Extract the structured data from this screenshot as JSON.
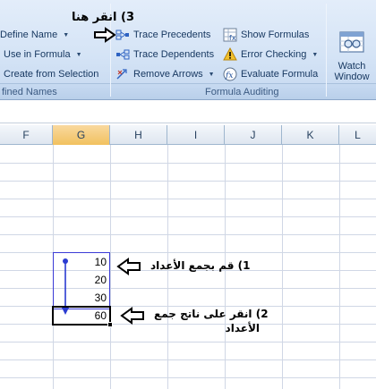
{
  "ribbon": {
    "defined_names": {
      "define_name_label": "Define Name",
      "use_in_formula_label": "Use in Formula",
      "create_from_selection_label": "Create from Selection",
      "group_label": "fined Names"
    },
    "formula_auditing": {
      "trace_precedents_label": "Trace Precedents",
      "trace_dependents_label": "Trace Dependents",
      "remove_arrows_label": "Remove Arrows",
      "show_formulas_label": "Show Formulas",
      "error_checking_label": "Error Checking",
      "evaluate_formula_label": "Evaluate Formula",
      "group_label": "Formula Auditing"
    },
    "watch_window": {
      "line1": "Watch",
      "line2": "Window"
    }
  },
  "sheet": {
    "columns": [
      "F",
      "G",
      "H",
      "I",
      "J",
      "K",
      "L"
    ],
    "selected_column": "G",
    "cells": {
      "g1": "10",
      "g2": "20",
      "g3": "30",
      "g4": "60"
    }
  },
  "annotations": {
    "step1": "1) قم بجمع الأعداد",
    "step2_line1": "2) انقر على ناتج جمع",
    "step2_line2": "الأعداد",
    "step3": "3) انقر هنا"
  },
  "colors": {
    "ribbon_bg": "#d5e4f6",
    "selected_header": "#f1c15f",
    "trace_arrow": "#2b3bd1"
  }
}
